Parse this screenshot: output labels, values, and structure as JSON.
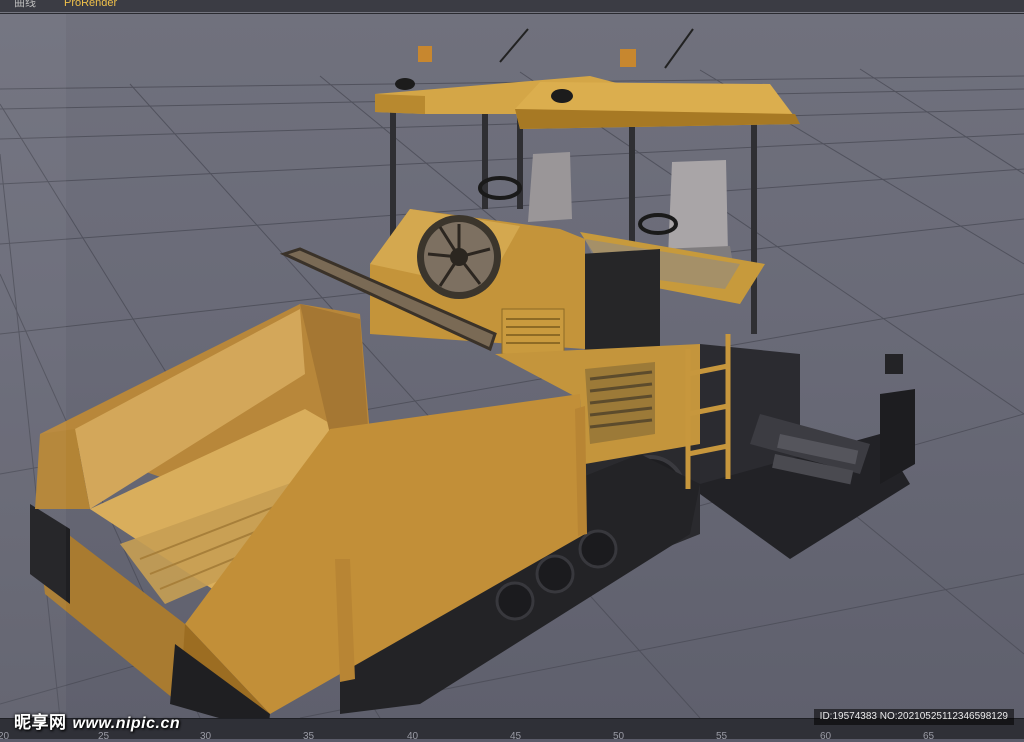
{
  "titlebar": {
    "tabs": [
      {
        "label": "曲线"
      },
      {
        "label": "ProRender"
      }
    ]
  },
  "viewport": {
    "subject": "asphalt-paver-3d-model"
  },
  "ruler": {
    "ticks": [
      "20",
      "25",
      "30",
      "35",
      "40",
      "45",
      "50",
      "55",
      "60",
      "65"
    ]
  },
  "watermark": {
    "site": "昵享网",
    "url": "www.nipic.cn"
  },
  "image_id": "ID:19574383 NO:20210525112346598129",
  "colors": {
    "body": "#c9962f",
    "body_dark": "#8f6418",
    "track": "#262629",
    "grid": "#4a4b55",
    "bg": "#6b6c79"
  }
}
